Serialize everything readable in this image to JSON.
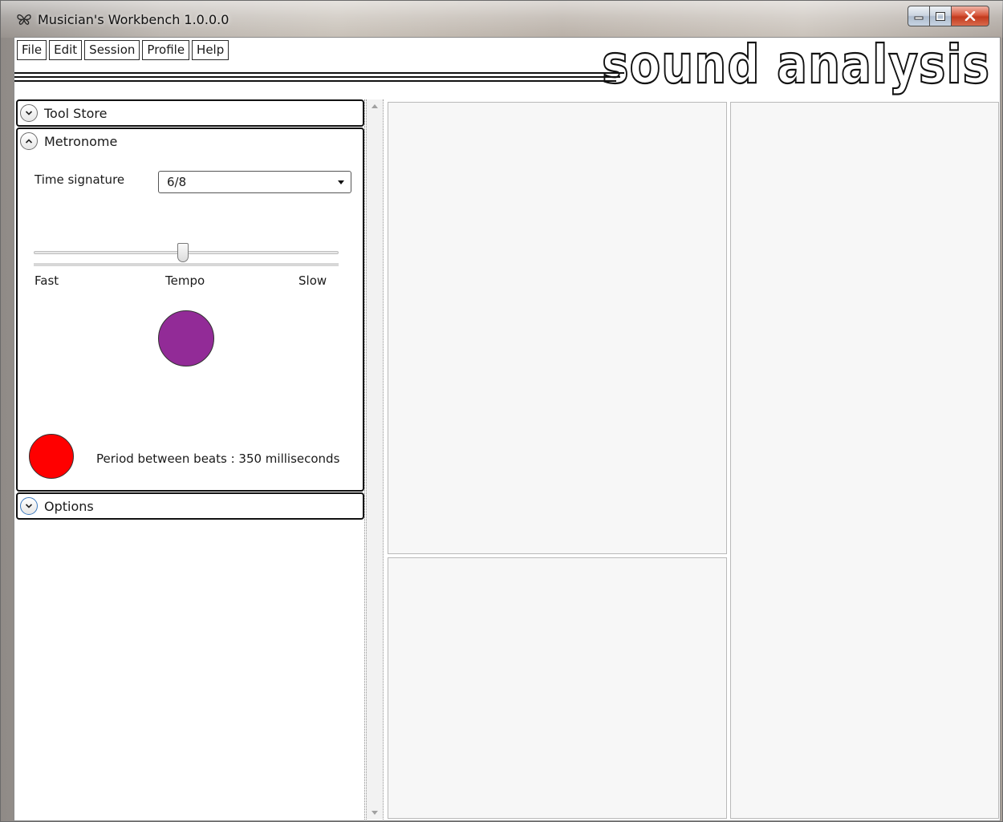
{
  "window": {
    "title": "Musician's Workbench 1.0.0.0"
  },
  "menu": {
    "items": [
      "File",
      "Edit",
      "Session",
      "Profile",
      "Help"
    ]
  },
  "logo_text": "sound analysis",
  "panels": {
    "tool_store": {
      "label": "Tool Store",
      "expanded": false
    },
    "metronome": {
      "label": "Metronome",
      "expanded": true,
      "time_signature_label": "Time signature",
      "time_signature_value": "6/8",
      "slider": {
        "left_label": "Fast",
        "center_label": "Tempo",
        "right_label": "Slow",
        "value_fraction": 0.49
      },
      "indicator_color": "#922b97",
      "beat_indicator_color": "#ff0000",
      "period_text": "Period between beats : 350 milliseconds"
    },
    "options": {
      "label": "Options",
      "expanded": false
    }
  },
  "colors": {
    "accent_blue": "#3d7bbf",
    "pane_background": "#f7f7f7",
    "close_red": "#c23a1e"
  },
  "icons": {
    "app": "butterfly-icon",
    "minimize": "minimize-icon",
    "maximize": "maximize-icon",
    "close": "close-icon",
    "expand": "chevron-down-icon",
    "collapse": "chevron-up-icon"
  }
}
